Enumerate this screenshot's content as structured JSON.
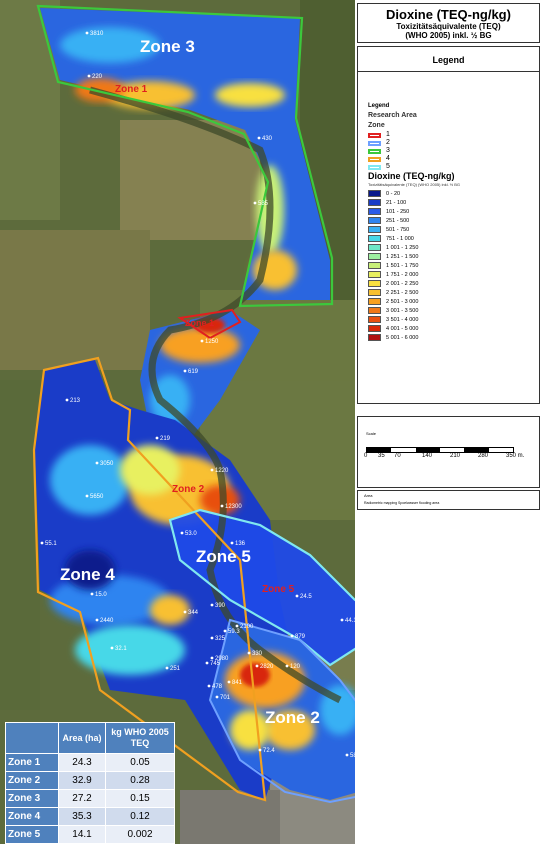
{
  "title": {
    "main": "Dioxine (TEQ-ng/kg)",
    "sub1": "Toxizitätsäquivalente (TEQ)",
    "sub2": "(WHO 2005) inkl. ½ BG"
  },
  "legend": {
    "header": "Legend",
    "small_title": "Legend",
    "research_area": "Research Area",
    "zone_title": "Zone",
    "zones": [
      {
        "label": "1",
        "color": "#e02020"
      },
      {
        "label": "2",
        "color": "#6ea0ff"
      },
      {
        "label": "3",
        "color": "#3cc83c"
      },
      {
        "label": "4",
        "color": "#f0a020"
      },
      {
        "label": "5",
        "color": "#80e8f0"
      }
    ],
    "dioxine_title": "Dioxine (TEQ-ng/kg)",
    "dioxine_sub": "Toxizitätsäquivalente (TEQ) (WHO 2005) inkl. ½ BG",
    "classes": [
      {
        "label": "0 - 20",
        "color": "#0a1a8c"
      },
      {
        "label": "21 - 100",
        "color": "#1a3cc8"
      },
      {
        "label": "101 - 250",
        "color": "#2a5ae8"
      },
      {
        "label": "251 - 500",
        "color": "#2f84f0"
      },
      {
        "label": "501 - 750",
        "color": "#38b0f4"
      },
      {
        "label": "751 - 1 000",
        "color": "#46d8e8"
      },
      {
        "label": "1 001 - 1 250",
        "color": "#6ee8c8"
      },
      {
        "label": "1 251 - 1 500",
        "color": "#9ef0a0"
      },
      {
        "label": "1 501 - 1 750",
        "color": "#c8f078"
      },
      {
        "label": "1 751 - 2 000",
        "color": "#e8f060"
      },
      {
        "label": "2 001 - 2 250",
        "color": "#f8e040"
      },
      {
        "label": "2 251 - 2 500",
        "color": "#f8c030"
      },
      {
        "label": "2 501 - 3 000",
        "color": "#f8a020"
      },
      {
        "label": "3 001 - 3 500",
        "color": "#f07818"
      },
      {
        "label": "3 501 - 4 000",
        "color": "#e85010"
      },
      {
        "label": "4 001 - 5 000",
        "color": "#d82808"
      },
      {
        "label": "5 001 - 6 000",
        "color": "#b01010"
      }
    ]
  },
  "scale": {
    "label": "Scale",
    "ticks": [
      "0",
      "35",
      "70",
      "140",
      "210",
      "280",
      "350 m."
    ]
  },
  "note": {
    "title": "Area",
    "text": "Radiometric mapping Spoelwasser flooding area"
  },
  "map": {
    "zone_labels": {
      "zone3": "Zone 3",
      "zone4": "Zone 4",
      "zone5": "Zone 5",
      "zone2": "Zone 2"
    },
    "inner_labels": {
      "zone1_top": "Zone 1",
      "zone1_mid": "Zone 1",
      "zone2_mid": "Zone 2",
      "zone5_mid": "Zone 5"
    },
    "points": [
      "3810",
      "220",
      "430",
      "585",
      "1250",
      "619",
      "213",
      "3050",
      "1220",
      "5650",
      "12300",
      "219",
      "55.1",
      "53.0",
      "136",
      "15.0",
      "24.5",
      "2440",
      "44.1",
      "344",
      "390",
      "32.1",
      "251",
      "2100",
      "59.3",
      "330",
      "325",
      "2980",
      "745",
      "2820",
      "879",
      "478",
      "841",
      "701",
      "72.4",
      "586",
      "120"
    ]
  },
  "table": {
    "headers": [
      "",
      "Area (ha)",
      "kg WHO 2005 TEQ"
    ],
    "rows": [
      {
        "zone": "Zone 1",
        "area": "24.3",
        "kg": "0.05"
      },
      {
        "zone": "Zone 2",
        "area": "32.9",
        "kg": "0.28"
      },
      {
        "zone": "Zone 3",
        "area": "27.2",
        "kg": "0.15"
      },
      {
        "zone": "Zone 4",
        "area": "35.3",
        "kg": "0.12"
      },
      {
        "zone": "Zone 5",
        "area": "14.1",
        "kg": "0.002"
      }
    ]
  }
}
